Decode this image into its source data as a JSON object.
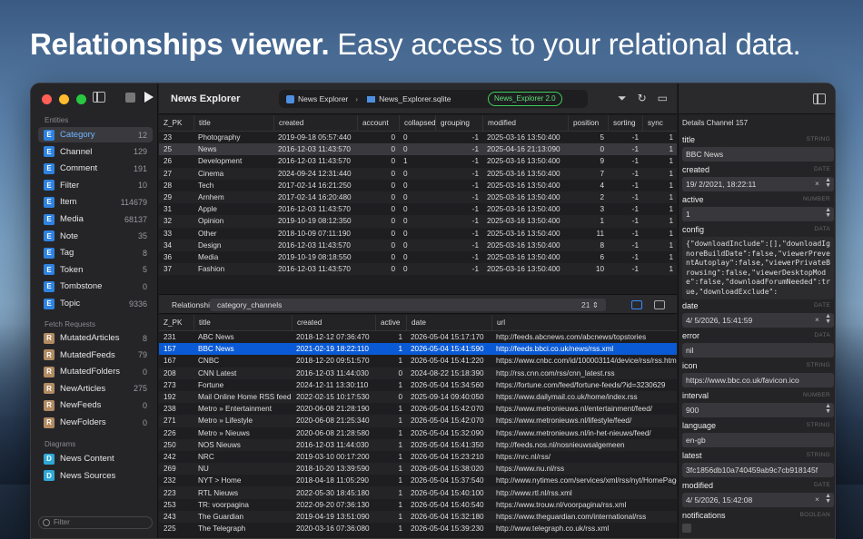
{
  "headline": {
    "bold": "Relationships viewer.",
    "light": " Easy access to your relational data."
  },
  "sidebar": {
    "entities_title": "Entities",
    "entities": [
      {
        "label": "Category",
        "count": "12",
        "badge": "E"
      },
      {
        "label": "Channel",
        "count": "129",
        "badge": "E"
      },
      {
        "label": "Comment",
        "count": "191",
        "badge": "E"
      },
      {
        "label": "Filter",
        "count": "10",
        "badge": "E"
      },
      {
        "label": "Item",
        "count": "114679",
        "badge": "E"
      },
      {
        "label": "Media",
        "count": "68137",
        "badge": "E"
      },
      {
        "label": "Note",
        "count": "35",
        "badge": "E"
      },
      {
        "label": "Tag",
        "count": "8",
        "badge": "E"
      },
      {
        "label": "Token",
        "count": "5",
        "badge": "E"
      },
      {
        "label": "Tombstone",
        "count": "0",
        "badge": "E"
      },
      {
        "label": "Topic",
        "count": "9336",
        "badge": "E"
      }
    ],
    "fetch_title": "Fetch Requests",
    "fetch": [
      {
        "label": "MutatedArticles",
        "count": "8",
        "badge": "R"
      },
      {
        "label": "MutatedFeeds",
        "count": "79",
        "badge": "R"
      },
      {
        "label": "MutatedFolders",
        "count": "0",
        "badge": "R"
      },
      {
        "label": "NewArticles",
        "count": "275",
        "badge": "R"
      },
      {
        "label": "NewFeeds",
        "count": "0",
        "badge": "R"
      },
      {
        "label": "NewFolders",
        "count": "0",
        "badge": "R"
      }
    ],
    "diagrams_title": "Diagrams",
    "diagrams": [
      {
        "label": "News Content",
        "badge": "D"
      },
      {
        "label": "News Sources",
        "badge": "D"
      }
    ],
    "filter_placeholder": "Filter"
  },
  "toolbar": {
    "title": "News Explorer",
    "path_app": "News Explorer",
    "path_file": "News_Explorer.sqlite",
    "version": "News_Explorer 2.0"
  },
  "top_table": {
    "columns": [
      "Z_PK",
      "title",
      "created",
      "account",
      "collapsed",
      "grouping",
      "modified",
      "position",
      "sorting",
      "sync"
    ],
    "rows": [
      [
        "23",
        "Photography",
        "2019-09-18 05:57:440",
        "0",
        "0",
        "-1",
        "2025-03-16 13:50:400",
        "5",
        "-1",
        "1"
      ],
      [
        "25",
        "News",
        "2016-12-03 11:43:570",
        "0",
        "0",
        "-1",
        "2025-04-16 21:13:090",
        "0",
        "-1",
        "1"
      ],
      [
        "26",
        "Development",
        "2016-12-03 11:43:570",
        "0",
        "1",
        "-1",
        "2025-03-16 13:50:400",
        "9",
        "-1",
        "1"
      ],
      [
        "27",
        "Cinema",
        "2024-09-24 12:31:440",
        "0",
        "0",
        "-1",
        "2025-03-16 13:50:400",
        "7",
        "-1",
        "1"
      ],
      [
        "28",
        "Tech",
        "2017-02-14 16:21:250",
        "0",
        "0",
        "-1",
        "2025-03-16 13:50:400",
        "4",
        "-1",
        "1"
      ],
      [
        "29",
        "Arnhem",
        "2017-02-14 16:20:480",
        "0",
        "0",
        "-1",
        "2025-03-16 13:50:400",
        "2",
        "-1",
        "1"
      ],
      [
        "31",
        "Apple",
        "2016-12-03 11:43:570",
        "0",
        "0",
        "-1",
        "2025-03-16 13:50:400",
        "3",
        "-1",
        "1"
      ],
      [
        "32",
        "Opinion",
        "2019-10-19 08:12:350",
        "0",
        "0",
        "-1",
        "2025-03-16 13:50:400",
        "1",
        "-1",
        "1"
      ],
      [
        "33",
        "Other",
        "2018-10-09 07:11:190",
        "0",
        "0",
        "-1",
        "2025-03-16 13:50:400",
        "11",
        "-1",
        "1"
      ],
      [
        "34",
        "Design",
        "2016-12-03 11:43:570",
        "0",
        "0",
        "-1",
        "2025-03-16 13:50:400",
        "8",
        "-1",
        "1"
      ],
      [
        "36",
        "Media",
        "2019-10-19 08:18:550",
        "0",
        "0",
        "-1",
        "2025-03-16 13:50:400",
        "6",
        "-1",
        "1"
      ],
      [
        "37",
        "Fashion",
        "2016-12-03 11:43:570",
        "0",
        "0",
        "-1",
        "2025-03-16 13:50:400",
        "10",
        "-1",
        "1"
      ]
    ]
  },
  "relationship": {
    "label": "Relationship:",
    "value": "category_channels",
    "count": "21"
  },
  "bottom_table": {
    "columns": [
      "Z_PK",
      "title",
      "created",
      "active",
      "date",
      "url"
    ],
    "rows": [
      [
        "231",
        "ABC News",
        "2018-12-12 07:36:470",
        "1",
        "2026-05-04 15:17:170",
        "http://feeds.abcnews.com/abcnews/topstories"
      ],
      [
        "157",
        "BBC News",
        "2021-02-19 18:22:110",
        "1",
        "2026-05-04 15:41:590",
        "http://feeds.bbci.co.uk/news/rss.xml"
      ],
      [
        "167",
        "CNBC",
        "2018-12-20 09:51:570",
        "1",
        "2026-05-04 15:41:220",
        "https://www.cnbc.com/id/100003114/device/rss/rss.html"
      ],
      [
        "208",
        "CNN Latest",
        "2016-12-03 11:44:030",
        "0",
        "2024-08-22 15:18:390",
        "http://rss.cnn.com/rss/cnn_latest.rss"
      ],
      [
        "273",
        "Fortune",
        "2024-12-11 13:30:110",
        "1",
        "2026-05-04 15:34:560",
        "https://fortune.com/feed/fortune-feeds/?id=3230629"
      ],
      [
        "192",
        "Mail Online Home RSS feed",
        "2022-02-15 10:17:530",
        "0",
        "2025-09-14 09:40:050",
        "https://www.dailymail.co.uk/home/index.rss"
      ],
      [
        "238",
        "Metro » Entertainment",
        "2020-06-08 21:28:190",
        "1",
        "2026-05-04 15:42:070",
        "https://www.metronieuws.nl/entertainment/feed/"
      ],
      [
        "271",
        "Metro » Lifestyle",
        "2020-06-08 21:25:340",
        "1",
        "2026-05-04 15:42:070",
        "https://www.metronieuws.nl/lifestyle/feed/"
      ],
      [
        "226",
        "Metro » Nieuws",
        "2020-06-08 21:28:580",
        "1",
        "2026-05-04 15:32:090",
        "https://www.metronieuws.nl/in-het-nieuws/feed/"
      ],
      [
        "250",
        "NOS Nieuws",
        "2016-12-03 11:44:030",
        "1",
        "2026-05-04 15:41:350",
        "http://feeds.nos.nl/nosnieuwsalgemeen"
      ],
      [
        "242",
        "NRC",
        "2019-03-10 00:17:200",
        "1",
        "2026-05-04 15:23:210",
        "https://nrc.nl/rss/"
      ],
      [
        "269",
        "NU",
        "2018-10-20 13:39:590",
        "1",
        "2026-05-04 15:38:020",
        "https://www.nu.nl/rss"
      ],
      [
        "232",
        "NYT > Home",
        "2018-04-18 11:05:290",
        "1",
        "2026-05-04 15:37:540",
        "http://www.nytimes.com/services/xml/rss/nyt/HomePage.xml"
      ],
      [
        "223",
        "RTL Nieuws",
        "2022-05-30 18:45:180",
        "1",
        "2026-05-04 15:40:100",
        "http://www.rtl.nl/rss.xml"
      ],
      [
        "253",
        "TR: voorpagina",
        "2022-09-20 07:36:130",
        "1",
        "2026-05-04 15:40:540",
        "https://www.trouw.nl/voorpagina/rss.xml"
      ],
      [
        "243",
        "The Guardian",
        "2019-04-19 13:51:090",
        "1",
        "2026-05-04 15:32:180",
        "https://www.theguardian.com/international/rss"
      ],
      [
        "225",
        "The Telegraph",
        "2020-03-16 07:36:080",
        "1",
        "2026-05-04 15:39:230",
        "http://www.telegraph.co.uk/rss.xml"
      ]
    ]
  },
  "details": {
    "header": "Details Channel  157",
    "fields": [
      {
        "label": "title",
        "type": "STRING",
        "value": "BBC News"
      },
      {
        "label": "created",
        "type": "DATE",
        "value": "19/  2/2021, 18:22:11"
      },
      {
        "label": "active",
        "type": "NUMBER",
        "value": "1"
      },
      {
        "label": "config",
        "type": "DATA",
        "value": "{\"downloadInclude\":[],\"downloadIgnoreBuildDate\":false,\"viewerPreventAutoplay\":false,\"viewerPrivateBrowsing\":false,\"viewerDesktopMode\":false,\"downloadForumNeeded\":true,\"downloadExclude\":"
      },
      {
        "label": "date",
        "type": "DATE",
        "value": "4/  5/2026, 15:41:59"
      },
      {
        "label": "error",
        "type": "DATA",
        "value": "nil"
      },
      {
        "label": "icon",
        "type": "STRING",
        "value": "https://www.bbc.co.uk/favicon.ico"
      },
      {
        "label": "interval",
        "type": "NUMBER",
        "value": "900"
      },
      {
        "label": "language",
        "type": "STRING",
        "value": "en-gb"
      },
      {
        "label": "latest",
        "type": "STRING",
        "value": "3fc1856db10a740459ab9c7cb918145f"
      },
      {
        "label": "modified",
        "type": "DATE",
        "value": "4/  5/2026, 15:42:08"
      },
      {
        "label": "notifications",
        "type": "BOOLEAN",
        "value": ""
      }
    ]
  }
}
